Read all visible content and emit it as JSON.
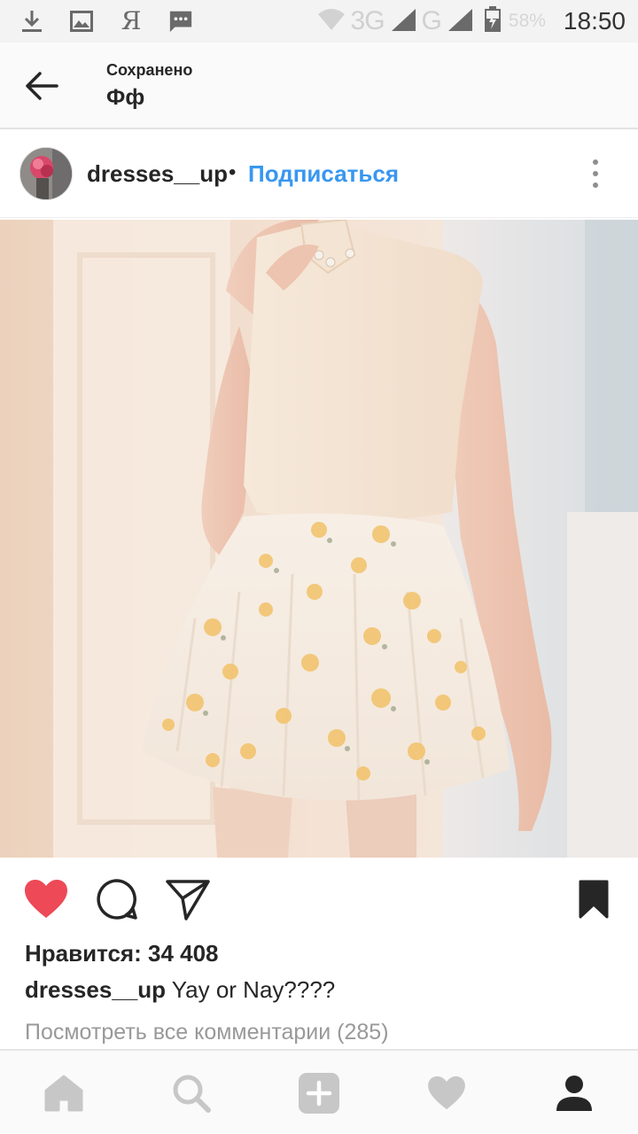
{
  "status_bar": {
    "ya_glyph": "Я",
    "network_1": "3G",
    "network_2": "G",
    "battery": "58%",
    "time": "18:50",
    "icons": [
      "download-icon",
      "image-icon",
      "yandex-icon",
      "message-icon",
      "wifi-icon",
      "signal-icon",
      "battery-icon"
    ]
  },
  "header": {
    "subtitle": "Сохранено",
    "title": "Фф"
  },
  "post": {
    "username": "dresses__up",
    "separator": "•",
    "follow_label": "Подписаться",
    "likes_text": "Нравится: 34 408",
    "caption_user": "dresses__up",
    "caption_text": " Yay or Nay????",
    "comments_link": "Посмотреть все комментарии (285)",
    "liked": true,
    "saved": true
  },
  "colors": {
    "accent_link": "#3897f0",
    "like_red": "#ed4956",
    "text": "#262626",
    "muted": "#999999"
  },
  "bottom_nav": [
    "home-icon",
    "search-icon",
    "add-post-icon",
    "activity-heart-icon",
    "profile-icon"
  ]
}
